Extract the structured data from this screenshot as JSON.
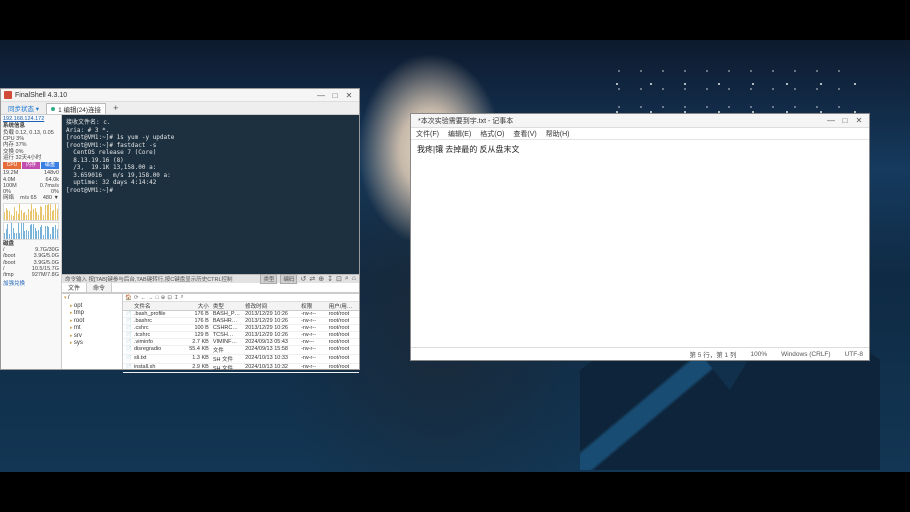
{
  "finalshell": {
    "title": "FinalShell 4.3.10",
    "win": {
      "min": "—",
      "max": "□",
      "close": "✕"
    },
    "tabbar": {
      "connect": "同步状态 ▾",
      "tab": "1 编辑(24)连接",
      "plus": "+"
    },
    "monitor": {
      "ip": "192.168.124.172",
      "head": "系统信息",
      "load": "负载 0.12, 0.13, 0.05",
      "cpu": "CPU  3%",
      "mem": "内存  37%",
      "swap": "交换  0%",
      "runtime": "运行  32天4小时",
      "bars": [
        {
          "label": "CPU",
          "color": "#e46d3a"
        },
        {
          "label": "内存",
          "color": "#c14db0"
        },
        {
          "label": "磁盘",
          "color": "#3a7fe4"
        }
      ],
      "rows": [
        [
          "19.2M",
          "148v0"
        ],
        [
          "4.0M",
          "64.0k"
        ],
        [
          "100M",
          "0.7ms/s"
        ],
        [
          "0%",
          "0%"
        ]
      ],
      "net": {
        "label": "网络",
        "up": "m/s 65",
        "down": "480 ▼"
      },
      "disk": {
        "head": "磁盘",
        "items": [
          [
            "/",
            "9.7G/30G"
          ],
          [
            "/boot",
            "3.9G/5.0G"
          ],
          [
            "/boot",
            "3.9G/5.0G"
          ],
          [
            "/",
            "10.5/15.7G"
          ],
          [
            "/tmp",
            "927M/7.8G"
          ]
        ]
      },
      "links": "加强兑换"
    },
    "terminal_lines": [
      "接收文件名: c.",
      "Aria: # 3 *.",
      "[root@VM1:~]# 1s yum -y update",
      "[root@VM1:~]# fastdact -s",
      "  CentOS release 7 (Core)",
      "  8.13.19.16 (8)",
      "  /3,  19.1K 13,158.00 a:",
      "  3.659016   m/s 19,158.00 a:",
      "  uptime: 32 days 4:14:42",
      "[root@VM1:~]#"
    ],
    "status": {
      "msg": "命令输入 按[TAB]键参与后台,TAB键转行,按C键盘显示历史CTRL控制",
      "chips": [
        "类型",
        "编码"
      ],
      "icons": [
        "↺",
        "⇄",
        "⊕",
        "↧",
        "⊡",
        "⌕",
        "⌂"
      ]
    },
    "midtabs": [
      "文件",
      "命令"
    ],
    "fm": {
      "tree": [
        {
          "name": "/",
          "open": true,
          "sub": [
            "opt",
            "tmp",
            "root",
            "mt",
            "srv",
            "sys"
          ]
        }
      ],
      "toolbar": [
        "🏠",
        "⟳",
        "←",
        "→",
        "□",
        "⊕",
        "⊡",
        "↧",
        "⌕"
      ],
      "cols": [
        "",
        "文件名",
        "大小",
        "类型",
        "修改时间",
        "权限",
        "用户/用户组"
      ],
      "rows": [
        {
          "ico": "📄",
          "name": ".bash_profile",
          "size": "176 B",
          "type": "BASH_PR…",
          "mod": "2013/12/29 10:26",
          "perm": "-rw-r--",
          "own": "root/root"
        },
        {
          "ico": "📄",
          "name": ".bashrc",
          "size": "176 B",
          "type": "BASHRC…",
          "mod": "2013/12/29 10:26",
          "perm": "-rw-r--",
          "own": "root/root"
        },
        {
          "ico": "📄",
          "name": ".cshrc",
          "size": "100 B",
          "type": "CSHRC…",
          "mod": "2013/12/29 10:26",
          "perm": "-rw-r--",
          "own": "root/root"
        },
        {
          "ico": "📄",
          "name": ".tcshrc",
          "size": "129 B",
          "type": "TCSH…",
          "mod": "2013/12/29 10:26",
          "perm": "-rw-r--",
          "own": "root/root"
        },
        {
          "ico": "📄",
          "name": ".viminfo",
          "size": "2.7 KB",
          "type": "VIMINFO…",
          "mod": "2024/09/13 05:43",
          "perm": "-rw---",
          "own": "root/root"
        },
        {
          "ico": "📄",
          "name": "disregradio",
          "size": "55.4 KB",
          "type": "文件",
          "mod": "2024/09/13 15:58",
          "perm": "-rw-r--",
          "own": "root/root"
        },
        {
          "ico": "📄",
          "name": "sli.txt",
          "size": "1.3 KB",
          "type": "SH 文件",
          "mod": "2024/10/13 10:33",
          "perm": "-rw-r--",
          "own": "root/root"
        },
        {
          "ico": "📄",
          "name": "install.sh",
          "size": "2.9 KB",
          "type": "SH 文件",
          "mod": "2024/10/13 10:32",
          "perm": "-rw-r--",
          "own": "root/root"
        }
      ]
    }
  },
  "notepad": {
    "title": "*本次实验需要到宇.txt  - 记事本",
    "menu": [
      "文件(F)",
      "编辑(E)",
      "格式(O)",
      "查看(V)",
      "帮助(H)"
    ],
    "content": "我疼|镶 去掉最的 反从盘末文",
    "status": {
      "pos": "第 5 行，第 1 列",
      "zoom": "100%",
      "eol": "Windows (CRLF)",
      "enc": "UTF-8"
    }
  }
}
